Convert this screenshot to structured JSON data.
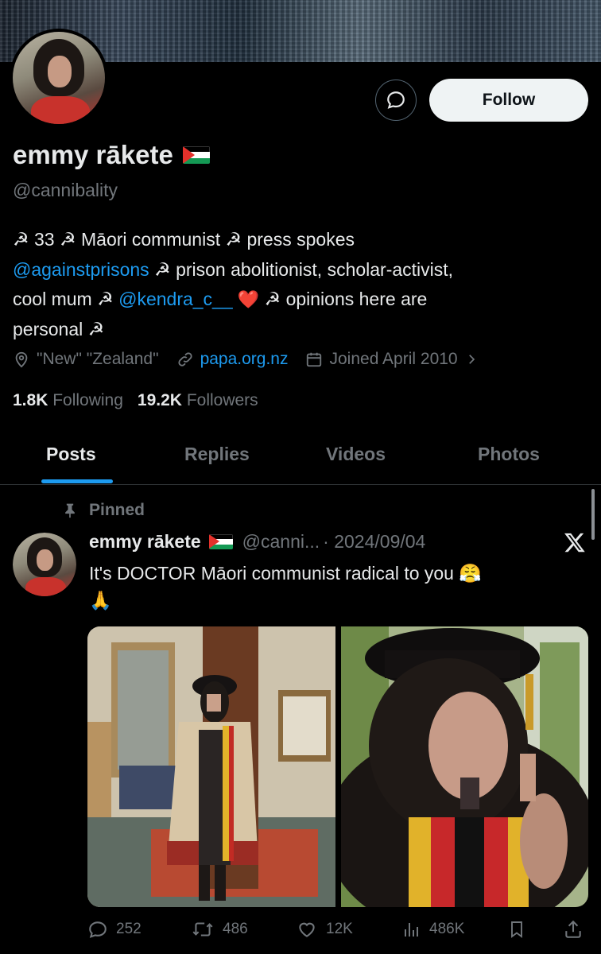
{
  "profile": {
    "name": "emmy rākete",
    "handle": "@cannibality",
    "follow_label": "Follow",
    "bio": {
      "line1": "☭ 33 ☭ Māori communist ☭ press spokes",
      "mention1": "@againstprisons",
      "line2_rest": " ☭ prison abolitionist, scholar-activist,",
      "line3_start": "cool mum ☭ ",
      "mention2": "@kendra_c__",
      "line3_rest": " ☭ opinions here are",
      "line4": "personal ☭"
    },
    "location": "\"New\" \"Zealand\"",
    "website": "papa.org.nz",
    "joined": "Joined April 2010",
    "following_count": "1.8K",
    "following_label": "Following",
    "followers_count": "19.2K",
    "followers_label": "Followers"
  },
  "tabs": [
    "Posts",
    "Replies",
    "Videos",
    "Photos"
  ],
  "post": {
    "pinned_label": "Pinned",
    "author_name": "emmy rākete",
    "author_handle": "@canni...",
    "date": "· 2024/09/04",
    "text": "It's DOCTOR Māori communist radical to you 😤",
    "text_line2": "🙏",
    "replies": "252",
    "reposts": "486",
    "likes": "12K",
    "views": "486K"
  },
  "colors": {
    "accent": "#1d9bf0",
    "text": "#e7e9ea",
    "muted": "#71767b",
    "background": "#000000"
  },
  "icons": [
    "message-icon",
    "location-icon",
    "link-icon",
    "calendar-icon",
    "chevron-right-icon",
    "pin-icon",
    "x-logo-icon",
    "reply-icon",
    "repost-icon",
    "like-icon",
    "views-icon",
    "bookmark-icon",
    "share-icon"
  ]
}
